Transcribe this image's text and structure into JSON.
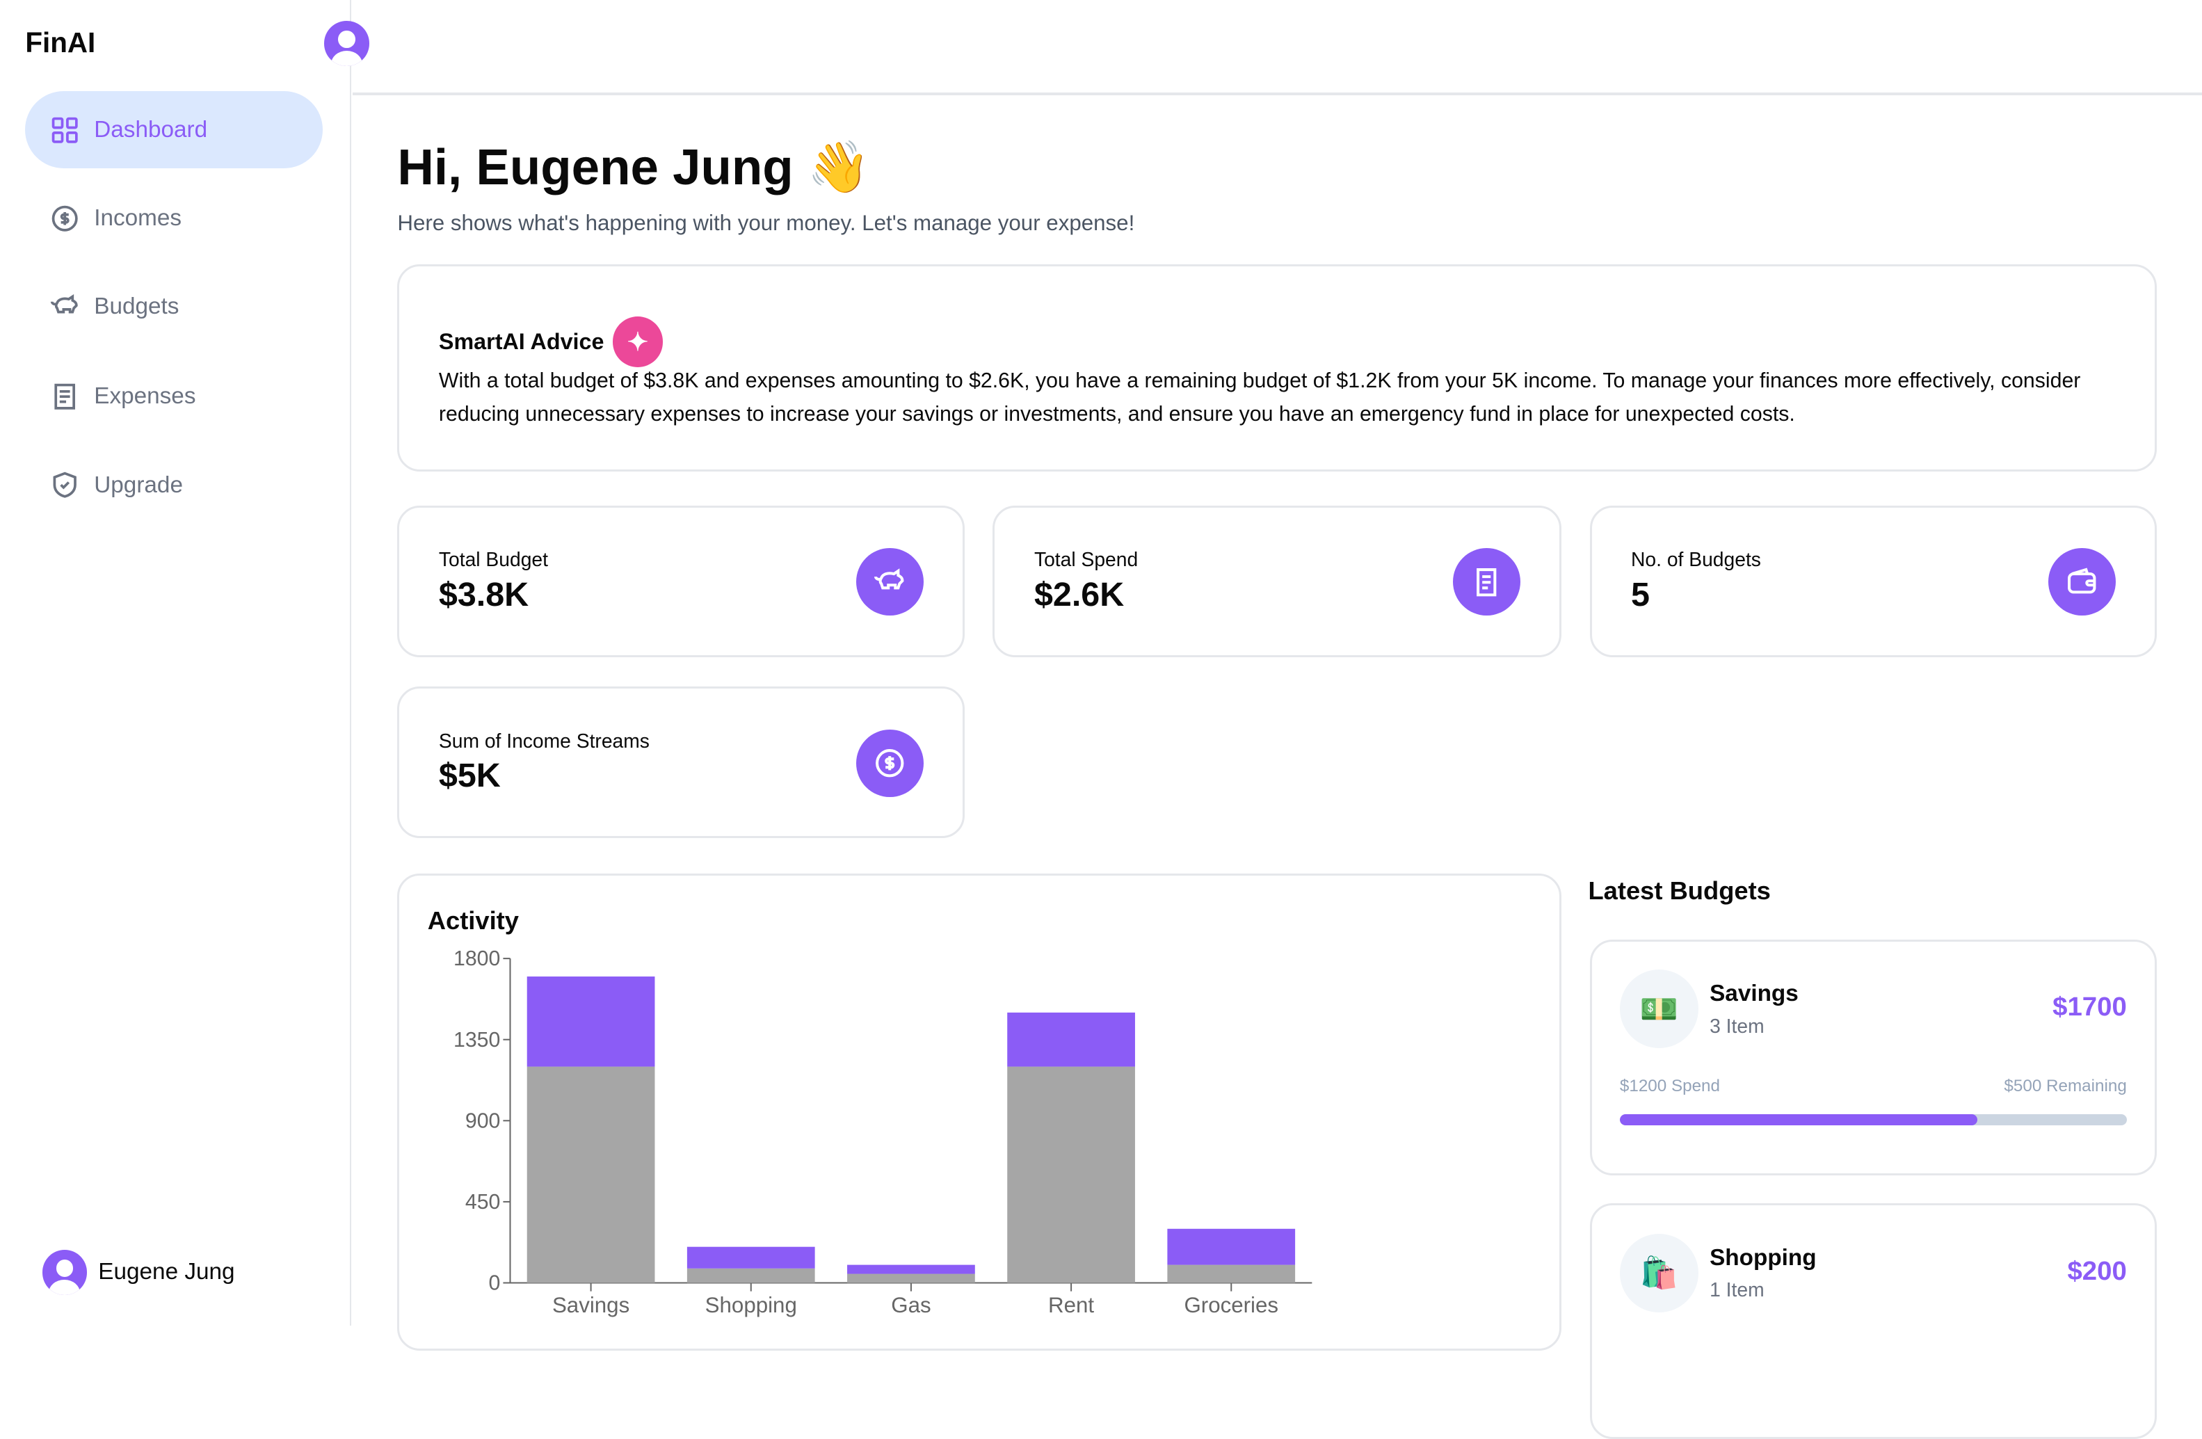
{
  "app": {
    "name": "FinAI"
  },
  "sidebar": {
    "items": [
      {
        "label": "Dashboard",
        "icon": "grid-icon",
        "active": true
      },
      {
        "label": "Incomes",
        "icon": "dollar-circle-icon"
      },
      {
        "label": "Budgets",
        "icon": "piggy-bank-icon"
      },
      {
        "label": "Expenses",
        "icon": "receipt-icon"
      },
      {
        "label": "Upgrade",
        "icon": "shield-check-icon"
      }
    ],
    "user": "Eugene Jung"
  },
  "header": {
    "greeting": "Hi, Eugene Jung 👋",
    "subtitle": "Here shows what's happening with your money. Let's manage your expense!"
  },
  "advice": {
    "title": "SmartAI Advice",
    "text": "With a total budget of $3.8K and expenses amounting to $2.6K, you have a remaining budget of $1.2K from your 5K income. To manage your finances more effectively, consider reducing unnecessary expenses to increase your savings or investments, and ensure you have an emergency fund in place for unexpected costs."
  },
  "stats": [
    {
      "label": "Total Budget",
      "value": "$3.8K",
      "icon": "piggy-bank-icon"
    },
    {
      "label": "Total Spend",
      "value": "$2.6K",
      "icon": "receipt-icon"
    },
    {
      "label": "No. of Budgets",
      "value": "5",
      "icon": "wallet-icon"
    },
    {
      "label": "Sum of Income Streams",
      "value": "$5K",
      "icon": "dollar-circle-icon"
    }
  ],
  "colors": {
    "accent": "#8b5cf6",
    "spend": "#a6a6a6",
    "remaining": "#8b5cf6"
  },
  "chart_data": {
    "type": "bar",
    "stacked": true,
    "title": "Activity",
    "categories": [
      "Savings",
      "Shopping",
      "Gas",
      "Rent",
      "Groceries"
    ],
    "series": [
      {
        "values": [
          1200,
          80,
          50,
          1200,
          100
        ],
        "color": "#a6a6a6"
      },
      {
        "values": [
          500,
          120,
          50,
          300,
          200
        ],
        "color": "#8b5cf6"
      }
    ],
    "ylim": [
      0,
      1800
    ],
    "yticks": [
      "0",
      "450",
      "900",
      "1350",
      "1800"
    ],
    "grid": false
  },
  "latest_budgets": {
    "title": "Latest Budgets",
    "items": [
      {
        "emoji": "💵",
        "name": "Savings",
        "items": "3 Item",
        "amount": "$1700",
        "spend": "$1200 Spend",
        "remaining": "$500 Remaining",
        "progress": 0.706
      },
      {
        "emoji": "🛍️",
        "name": "Shopping",
        "items": "1 Item",
        "amount": "$200"
      }
    ]
  }
}
